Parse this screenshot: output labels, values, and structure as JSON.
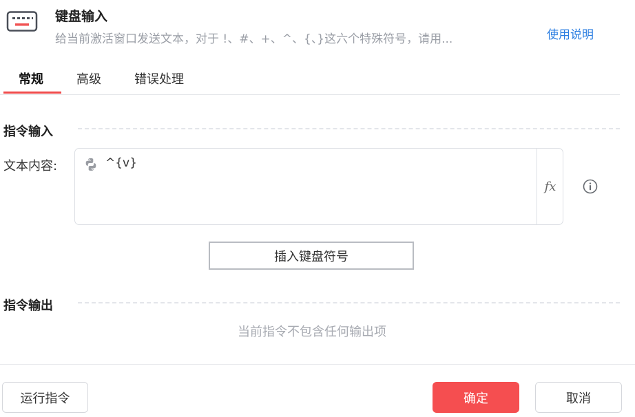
{
  "header": {
    "title": "键盘输入",
    "description": "给当前激活窗口发送文本，对于 !、#、+、^、{、}这六个特殊符号，请用...",
    "help_link": "使用说明",
    "icon": "keyboard-icon"
  },
  "tabs": [
    {
      "label": "常规",
      "active": true
    },
    {
      "label": "高级",
      "active": false
    },
    {
      "label": "错误处理",
      "active": false
    }
  ],
  "input_section": {
    "title": "指令输入",
    "text_content_label": "文本内容:",
    "text_content_value": "^{v}",
    "fx_label": "fx",
    "insert_button_label": "插入键盘符号"
  },
  "output_section": {
    "title": "指令输出",
    "empty_message": "当前指令不包含任何输出项"
  },
  "footer": {
    "run_label": "运行指令",
    "ok_label": "确定",
    "cancel_label": "取消"
  },
  "colors": {
    "accent": "#f54e50",
    "link": "#2a7de1",
    "tab_underline": "#f04a4a"
  }
}
